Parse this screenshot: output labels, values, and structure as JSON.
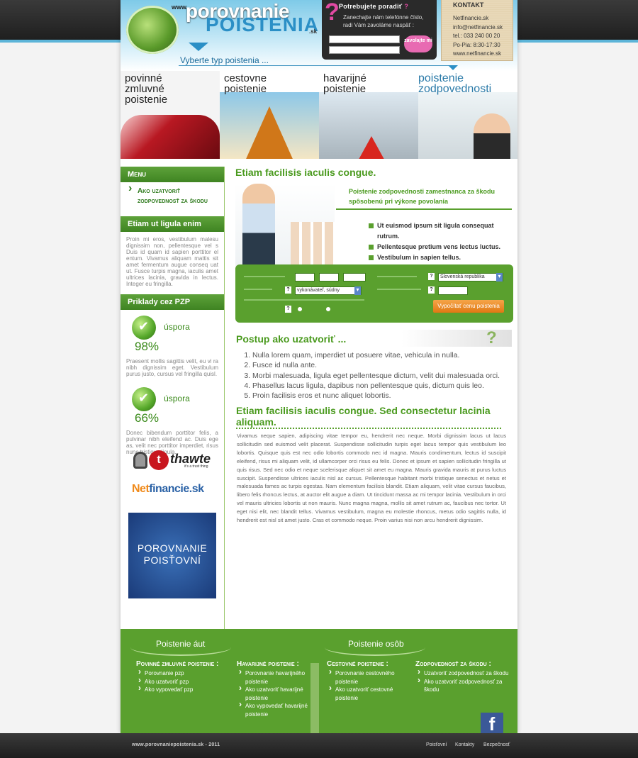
{
  "header": {
    "logo_www": "www.",
    "logo_top": "porovnanie",
    "logo_bottom": "POISTENIA",
    "logo_sk": ".sk",
    "choose_type": "Vyberte typ poistenia ..."
  },
  "callback": {
    "title": "Potrebujete poradiť",
    "qmark": "?",
    "text": "Zanechajte nám telefónne číslo, radi Vám zavoláme naspäť :",
    "button": "zavolajte mi"
  },
  "contact": {
    "title": "KONTAKT",
    "lines": [
      "Netfinancie.sk",
      "info@netfinancie.sk",
      "tel.: 033 240 00 20",
      "Po-Pia: 8:30-17:30",
      "www.netfinancie.sk"
    ]
  },
  "banners": [
    {
      "label": "povinné zmluvné poistenie"
    },
    {
      "label": "cestovne poistenie"
    },
    {
      "label": "havarijné poistenie"
    },
    {
      "label": "poistenie zodpovednosti"
    }
  ],
  "sidebar": {
    "menu_title": "Menu",
    "menu_link": "Ako uzatvoriť zodpovednosť za škodu",
    "box1_title": "Etiam ut ligula enim",
    "box1_text": "Proin mi eros, vestibulum malesu dignissim non, pellentesque vel s Duis id quam id sapien porttitor el entum. Vivamus aliquam mattis sit amet fermentum augue conseq uat ut. Fusce turpis magna, iaculis amet ultrices lacinia, gravida in lectus. Integer eu fringilla.",
    "box2_title": "Priklady cez PZP",
    "save1_label": "úspora",
    "save1_pct": "98%",
    "save1_text": "Praesent mollis sagittis velit, eu vi ra nibh dignissim eget. Vestibulum purus justo, cursus vel fringilla quisl.",
    "save2_label": "úspora",
    "save2_pct": "66%",
    "save2_text": "Donec bibendum porttitor felis, a pulvinar nibh eleifend ac. Duis ege as, velit nec porttitor imperdiet, risus nunc tristique ligula.",
    "thawte": "thawte",
    "thawte_sub": "it's a trust thing",
    "netf_a": "Net",
    "netf_b": "financie.sk",
    "porov_banner": "POROVNANIE POISŤOVNÍ"
  },
  "main": {
    "title1": "Etiam facilisis iaculis congue.",
    "intro_head": "Poistenie zodpovednosti zamestnanca za škodu spôsobenú pri výkone povolania",
    "bullets": [
      "Ut euismod ipsum sit ligula consequat rutrum.",
      "Pellentesque pretium vens lectus luctus.",
      "Vestibulum in sapien tellus."
    ],
    "calc": {
      "occupation_value": "vykonávateľ, súdny",
      "country_value": "Slovenská republika",
      "button": "Vypočítať cenu poistenia",
      "qmark": "?"
    },
    "steps_title": "Postup ako uzatvoriť ...",
    "steps": [
      "Nulla lorem quam, imperdiet ut posuere vitae, vehicula in nulla.",
      "Fusce id nulla ante.",
      "Morbi malesuada, ligula eget pellentesque dictum, velit dui malesuada orci.",
      "Phasellus lacus ligula, dapibus non pellentesque quis, dictum quis leo.",
      "Proin facilisis eros et nunc aliquet lobortis."
    ],
    "title2": "Etiam facilisis iaculis congue. Sed consectetur lacinia aliquam.",
    "body": "Vivamus neque sapien, adipiscing vitae tempor eu, hendrerit nec neque. Morbi dignissim lacus ut lacus sollicitudin sed euismod velit placerat. Suspendisse sollicitudin turpis eget lacus tempor quis vestibulum leo lobortis. Quisque quis est nec odio lobortis commodo nec id magna. Mauris condimentum, lectus id suscipit eleifend, risus mi aliquam velit, id ullamcorper orci risus eu felis. Donec et ipsum et sapien sollicitudin fringilla ut quis risus. Sed nec odio et neque scelerisque aliquet sit amet eu magna. Mauris gravida mauris at purus luctus suscipit. Suspendisse ultrices iaculis nisl ac cursus. Pellentesque habitant morbi tristique senectus et netus et malesuada fames ac turpis egestas. Nam elementum facilisis blandit. Etiam aliquam, velit vitae cursus faucibus, libero felis rhoncus lectus, at auctor elit augue a diam. Ut tincidunt massa ac mi tempor lacinia. Vestibulum in orci vel mauris ultricies lobortis ut non mauris. Nunc magna magna, mollis sit amet rutrum ac, faucibus nec tortor. Ut eget nisi elit, nec blandit tellus. Vivamus vestibulum, magna eu molestie rhoncus, metus odio sagittis nulla, id hendrerit est nisl sit amet justo. Cras et commodo neque. Proin varius nisi non arcu hendrerit dignissim."
  },
  "footer": {
    "head_auto": "Poistenie áut",
    "head_osob": "Poistenie osôb",
    "col1_title": "Povinné zmluvné poistenie :",
    "col1_items": [
      "Porovnanie pzp",
      "Ako uzatvoriť pzp",
      "Ako vypovedať pzp"
    ],
    "col2_title": "Havarijné poistenie :",
    "col2_items": [
      "Porovnanie havarijného poistenie",
      "Ako uzatvoriť havarijné poistenie",
      "Ako vypovedať havarijné poistenie"
    ],
    "col3_title": "Cestovné poistenie :",
    "col3_items": [
      "Porovnanie cestovného poistenie",
      "Ako uzatvoriť cestovné poistenie"
    ],
    "col4_title": "Zodpovednosť za škodu :",
    "col4_items": [
      "Uzatvoriť zodpovednosť za škodu",
      "Ako uzatvoriť zodpovednosť za škodu"
    ],
    "fb": "f"
  },
  "bottom": {
    "copyright": "www.porovnaniepoistenia.sk - 2011",
    "links": [
      "Poisťovní",
      "Kontakty",
      "Bezpečnosť"
    ]
  },
  "colors": {
    "brand_green": "#5aa02e",
    "brand_blue": "#2b8fc6",
    "accent_pink": "#e24aa3",
    "cta_orange": "#e07812"
  }
}
